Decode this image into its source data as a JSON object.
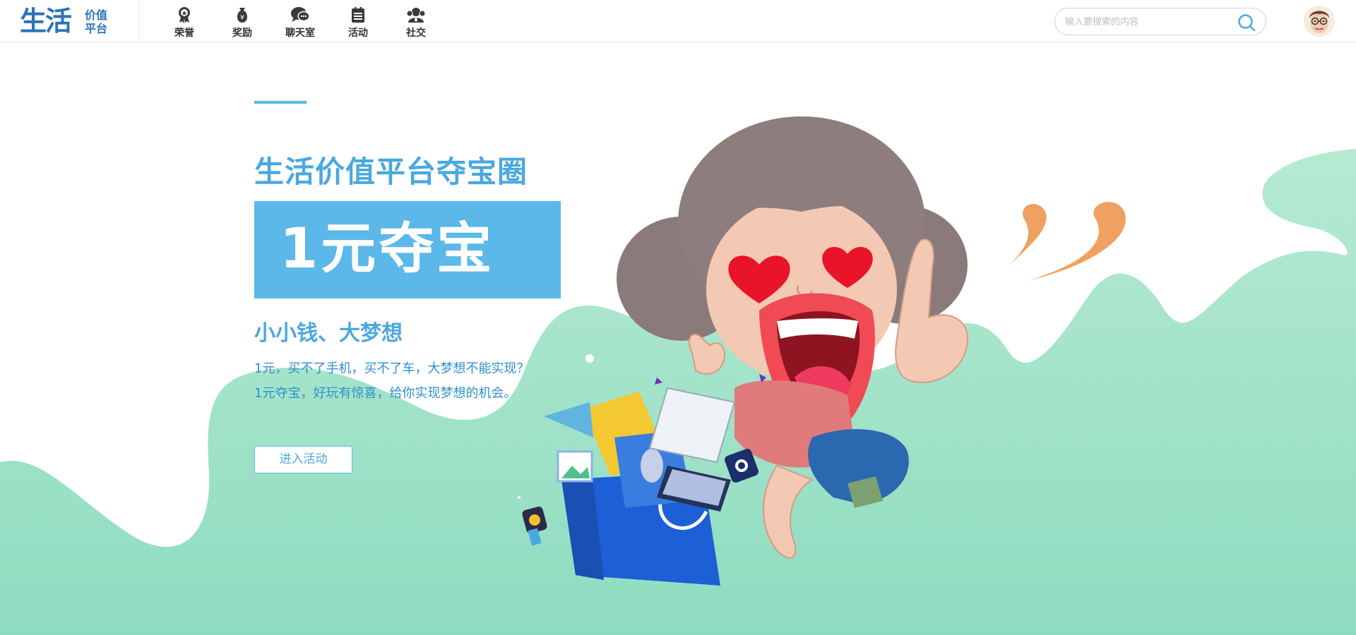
{
  "header": {
    "logo_main": "生活",
    "logo_sub": "价值平台",
    "nav": [
      {
        "label": "荣誉",
        "icon": "medal-icon"
      },
      {
        "label": "奖励",
        "icon": "money-bag-icon"
      },
      {
        "label": "聊天室",
        "icon": "chat-bubble-icon"
      },
      {
        "label": "活动",
        "icon": "calendar-icon"
      },
      {
        "label": "社交",
        "icon": "people-icon"
      }
    ],
    "search": {
      "placeholder": "输入要搜索的内容",
      "value": ""
    }
  },
  "hero": {
    "headline": "生活价值平台夺宝圈",
    "banner": "1元夺宝",
    "subheadline": "小小钱、大梦想",
    "description": [
      "1元，买不了手机，买不了车，大梦想不能实现？",
      "1元夺宝，好玩有惊喜，给你实现梦想的机会。"
    ],
    "cta_label": "进入活动"
  },
  "colors": {
    "brand": "#2b73b9",
    "accent": "#5bb8e9",
    "wave": "#a8e6cc",
    "text": "#4aa8df"
  }
}
